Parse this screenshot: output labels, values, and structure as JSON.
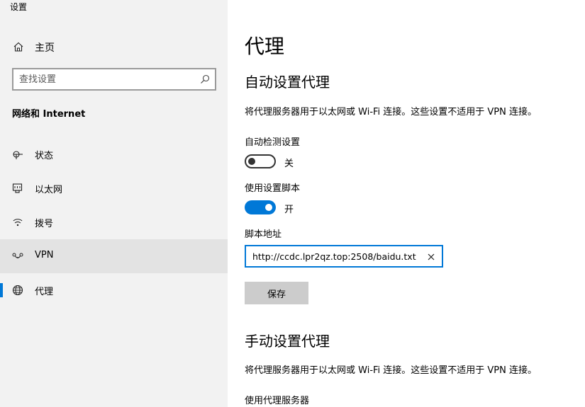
{
  "window": {
    "title": "设置"
  },
  "sidebar": {
    "home_label": "主页",
    "search_placeholder": "查找设置",
    "section_title": "网络和 Internet",
    "items": [
      {
        "label": "状态",
        "icon": "status-icon"
      },
      {
        "label": "以太网",
        "icon": "ethernet-icon"
      },
      {
        "label": "拨号",
        "icon": "dialup-icon"
      },
      {
        "label": "VPN",
        "icon": "vpn-icon"
      },
      {
        "label": "代理",
        "icon": "globe-icon"
      }
    ],
    "selected_item": "代理",
    "hovered_item": "VPN"
  },
  "main": {
    "page_title": "代理",
    "auto_section": {
      "title": "自动设置代理",
      "description": "将代理服务器用于以太网或 Wi-Fi 连接。这些设置不适用于 VPN 连接。",
      "auto_detect_label": "自动检测设置",
      "auto_detect_state": "关",
      "use_script_label": "使用设置脚本",
      "use_script_state": "开",
      "script_address_label": "脚本地址",
      "script_address_value": "http://ccdc.lpr2qz.top:2508/baidu.txt",
      "save_label": "保存"
    },
    "manual_section": {
      "title": "手动设置代理",
      "description": "将代理服务器用于以太网或 Wi-Fi 连接。这些设置不适用于 VPN 连接。",
      "use_proxy_label": "使用代理服务器"
    }
  },
  "colors": {
    "accent": "#0078d7",
    "sidebar_bg": "#f2f2f2",
    "hover_bg": "#e3e3e3",
    "button_bg": "#cccccc"
  }
}
